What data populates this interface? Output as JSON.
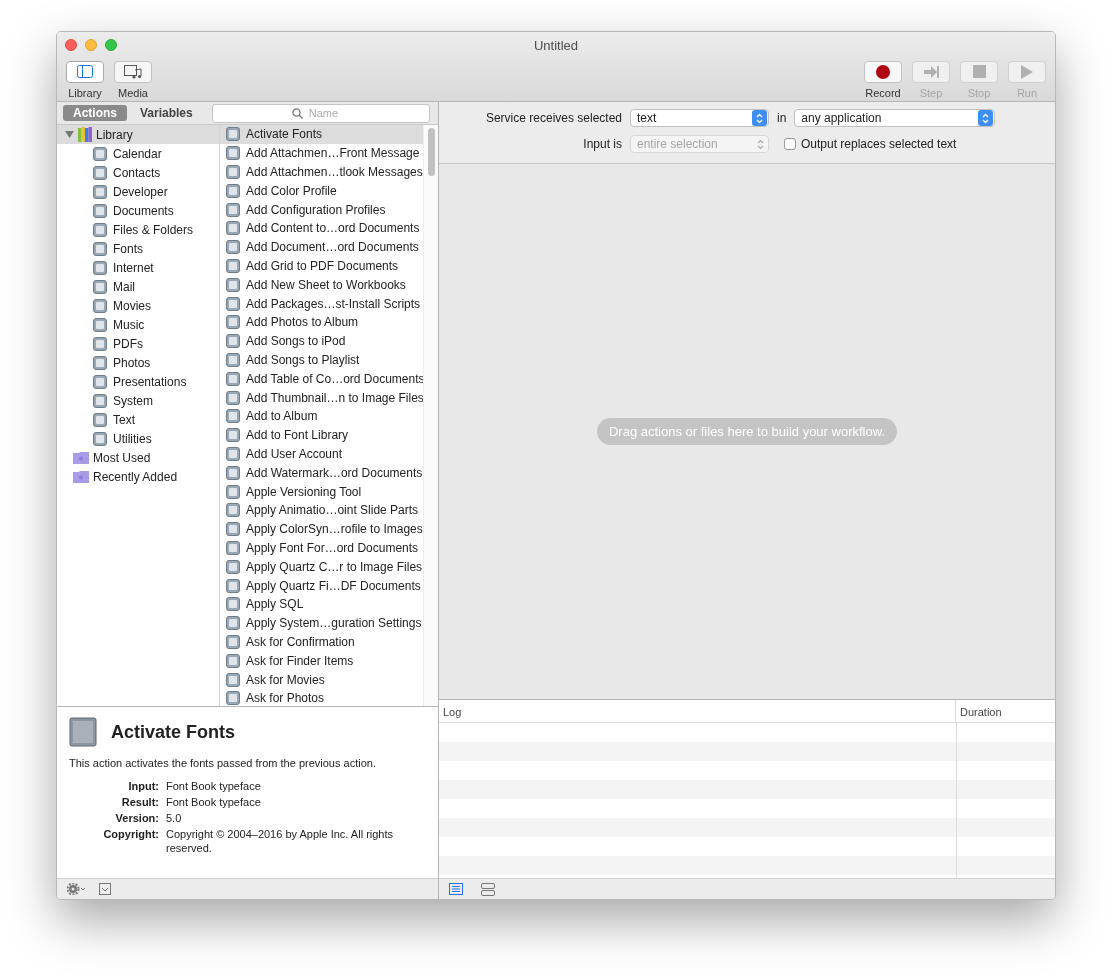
{
  "window": {
    "title": "Untitled"
  },
  "toolbar": {
    "left": [
      {
        "label": "Library",
        "kind": "library",
        "selected": true
      },
      {
        "label": "Media",
        "kind": "media",
        "selected": false
      }
    ],
    "right": [
      {
        "label": "Record",
        "kind": "record",
        "disabled": false
      },
      {
        "label": "Step",
        "kind": "step",
        "disabled": true
      },
      {
        "label": "Stop",
        "kind": "stop",
        "disabled": true
      },
      {
        "label": "Run",
        "kind": "run",
        "disabled": true
      }
    ]
  },
  "tabs": [
    {
      "label": "Actions",
      "selected": true
    },
    {
      "label": "Variables",
      "selected": false
    }
  ],
  "search": {
    "placeholder": "Name"
  },
  "library_tree": [
    {
      "label": "Library",
      "kind": "library",
      "expanded": true,
      "selected": true,
      "children": [
        {
          "label": "Calendar"
        },
        {
          "label": "Contacts"
        },
        {
          "label": "Developer"
        },
        {
          "label": "Documents"
        },
        {
          "label": "Files & Folders"
        },
        {
          "label": "Fonts"
        },
        {
          "label": "Internet"
        },
        {
          "label": "Mail"
        },
        {
          "label": "Movies"
        },
        {
          "label": "Music"
        },
        {
          "label": "PDFs"
        },
        {
          "label": "Photos"
        },
        {
          "label": "Presentations"
        },
        {
          "label": "System"
        },
        {
          "label": "Text"
        },
        {
          "label": "Utilities"
        }
      ]
    },
    {
      "label": "Most Used",
      "kind": "folder",
      "selected": false
    },
    {
      "label": "Recently Added",
      "kind": "folder",
      "selected": false
    }
  ],
  "actions": [
    {
      "label": "Activate Fonts",
      "selected": true
    },
    {
      "label": "Add Attachmen…Front Message",
      "selected": false
    },
    {
      "label": "Add Attachmen…tlook Messages",
      "selected": false
    },
    {
      "label": "Add Color Profile",
      "selected": false
    },
    {
      "label": "Add Configuration Profiles",
      "selected": false
    },
    {
      "label": "Add Content to…ord Documents",
      "selected": false
    },
    {
      "label": "Add Document…ord Documents",
      "selected": false
    },
    {
      "label": "Add Grid to PDF Documents",
      "selected": false
    },
    {
      "label": "Add New Sheet to Workbooks",
      "selected": false
    },
    {
      "label": "Add Packages…st-Install Scripts",
      "selected": false
    },
    {
      "label": "Add Photos to Album",
      "selected": false
    },
    {
      "label": "Add Songs to iPod",
      "selected": false
    },
    {
      "label": "Add Songs to Playlist",
      "selected": false
    },
    {
      "label": "Add Table of Co…ord Documents",
      "selected": false
    },
    {
      "label": "Add Thumbnail…n to Image Files",
      "selected": false
    },
    {
      "label": "Add to Album",
      "selected": false
    },
    {
      "label": "Add to Font Library",
      "selected": false
    },
    {
      "label": "Add User Account",
      "selected": false
    },
    {
      "label": "Add Watermark…ord Documents",
      "selected": false
    },
    {
      "label": "Apple Versioning Tool",
      "selected": false
    },
    {
      "label": "Apply Animatio…oint Slide Parts",
      "selected": false
    },
    {
      "label": "Apply ColorSyn…rofile to Images",
      "selected": false
    },
    {
      "label": "Apply Font For…ord Documents",
      "selected": false
    },
    {
      "label": "Apply Quartz C…r to Image Files",
      "selected": false
    },
    {
      "label": "Apply Quartz Fi…DF Documents",
      "selected": false
    },
    {
      "label": "Apply SQL",
      "selected": false
    },
    {
      "label": "Apply System…guration Settings",
      "selected": false
    },
    {
      "label": "Ask for Confirmation",
      "selected": false
    },
    {
      "label": "Ask for Finder Items",
      "selected": false
    },
    {
      "label": "Ask for Movies",
      "selected": false
    },
    {
      "label": "Ask for Photos",
      "selected": false
    }
  ],
  "description": {
    "title": "Activate Fonts",
    "text": "This action activates the fonts passed from the previous action.",
    "fields": [
      {
        "label": "Input:",
        "value": "Font Book typeface"
      },
      {
        "label": "Result:",
        "value": "Font Book typeface"
      },
      {
        "label": "Version:",
        "value": "5.0"
      },
      {
        "label": "Copyright:",
        "value": "Copyright © 2004–2016 by Apple Inc. All rights reserved."
      }
    ]
  },
  "service": {
    "receives_label": "Service receives selected",
    "receives_value": "text",
    "in_label": "in",
    "app_value": "any application",
    "input_label": "Input is",
    "input_value": "entire selection",
    "input_disabled": true,
    "output_label": "Output replaces selected text",
    "output_checked": false
  },
  "canvas": {
    "hint": "Drag actions or files here to build your workflow."
  },
  "log": {
    "columns": [
      "Log",
      "Duration"
    ]
  },
  "log_view_buttons": [
    {
      "kind": "list",
      "selected": true
    },
    {
      "kind": "split",
      "selected": false
    }
  ]
}
